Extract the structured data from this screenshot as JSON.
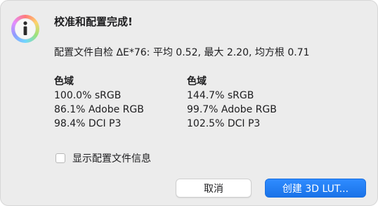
{
  "dialog": {
    "icon": "info-icon",
    "title": "校准和配置完成!",
    "profile_check": "配置文件自检 ΔE*76: 平均 0.52, 最大 2.20, 均方根 0.71",
    "gamut_left": {
      "header": "色域",
      "lines": [
        "100.0% sRGB",
        "86.1% Adobe RGB",
        "98.4% DCI P3"
      ]
    },
    "gamut_right": {
      "header": "色域",
      "lines": [
        "144.7% sRGB",
        "99.7% Adobe RGB",
        "102.5% DCI P3"
      ]
    },
    "checkbox": {
      "label": "显示配置文件信息",
      "checked": false
    },
    "buttons": {
      "cancel": "取消",
      "create": "创建 3D LUT..."
    },
    "accent_color": "#1a73e8"
  }
}
